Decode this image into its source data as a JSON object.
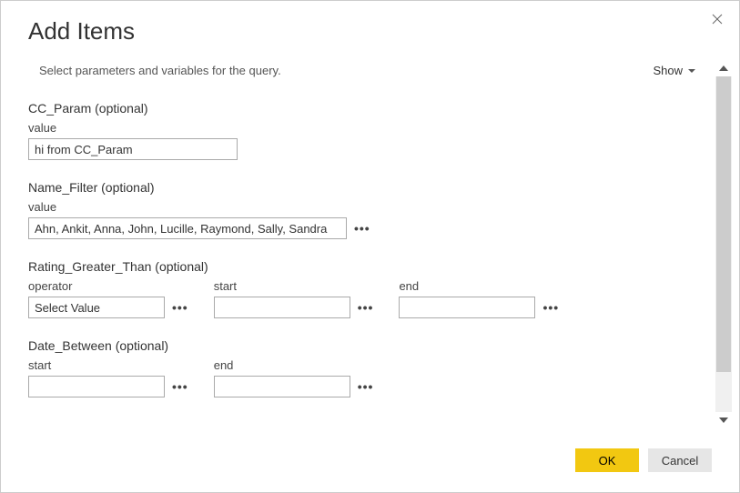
{
  "dialog": {
    "title": "Add Items",
    "instructions": "Select parameters and variables for the query.",
    "show_label": "Show"
  },
  "params": {
    "cc_param": {
      "title": "CC_Param (optional)",
      "value_label": "value",
      "value": "hi from CC_Param"
    },
    "name_filter": {
      "title": "Name_Filter (optional)",
      "value_label": "value",
      "value": "Ahn, Ankit, Anna, John, Lucille, Raymond, Sally, Sandra"
    },
    "rating_gt": {
      "title": "Rating_Greater_Than (optional)",
      "operator_label": "operator",
      "operator_value": "Select Value",
      "start_label": "start",
      "start_value": "",
      "end_label": "end",
      "end_value": ""
    },
    "date_between": {
      "title": "Date_Between (optional)",
      "start_label": "start",
      "start_value": "",
      "end_label": "end",
      "end_value": ""
    }
  },
  "buttons": {
    "ok": "OK",
    "cancel": "Cancel"
  }
}
